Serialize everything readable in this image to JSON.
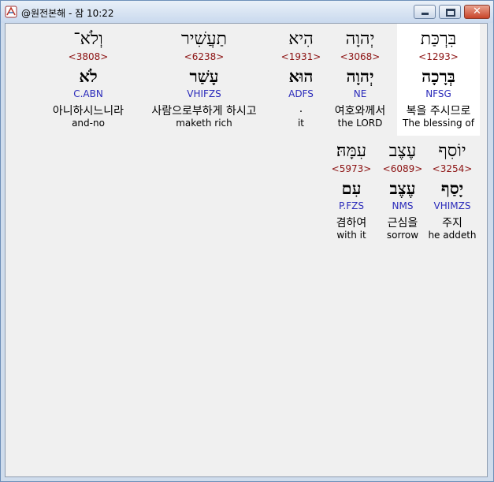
{
  "window": {
    "title": "@원전본해 - 잠 10:22"
  },
  "rows": [
    {
      "words": [
        {
          "hebrew": "וְלֹא־",
          "strong": "<3808>",
          "root": "לֹא",
          "morph": "C.ABN",
          "korean": "아니하시느니라",
          "english": "and-no"
        },
        {
          "hebrew": "תַעֲשִׁיר",
          "strong": "<6238>",
          "root": "עָשַׁר",
          "morph": "VHIFZS",
          "korean": "사람으로부하게 하시고",
          "english": "maketh rich"
        },
        {
          "hebrew": "הִיא",
          "strong": "<1931>",
          "root": "הוּא",
          "morph": "ADFS",
          "korean": ".",
          "english": "it"
        },
        {
          "hebrew": "יְהוָה",
          "strong": "<3068>",
          "root": "יְהוָה",
          "morph": "NE",
          "korean": "여호와께서",
          "english": "the LORD"
        },
        {
          "hebrew": "בִּרְכַּת",
          "strong": "<1293>",
          "root": "בְּרָכָה",
          "morph": "NFSG",
          "korean": "복을 주시므로",
          "english": "The blessing of"
        }
      ]
    },
    {
      "words": [
        {
          "hebrew": "עִמָּהּ׃",
          "strong": "<5973>",
          "root": "עִם",
          "morph": "P.FZS",
          "korean": "겸하여",
          "english": "with it"
        },
        {
          "hebrew": "עֶצֶב",
          "strong": "<6089>",
          "root": "עֶצֶב",
          "morph": "NMS",
          "korean": "근심을",
          "english": "sorrow"
        },
        {
          "hebrew": "יוֹסִף",
          "strong": "<3254>",
          "root": "יָסַף",
          "morph": "VHIMZS",
          "korean": "주지",
          "english": "he addeth"
        }
      ]
    }
  ]
}
